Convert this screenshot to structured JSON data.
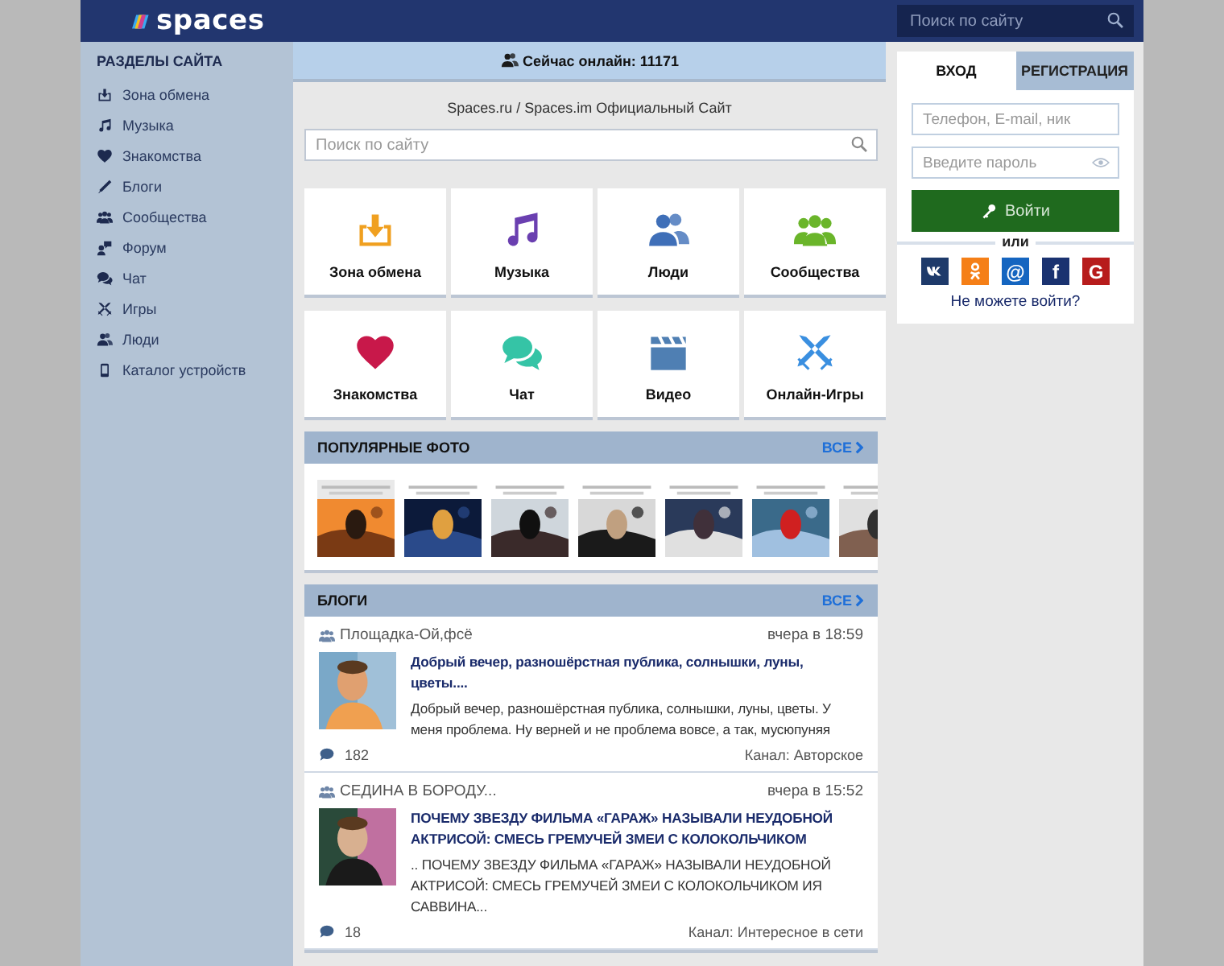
{
  "header": {
    "logo": "spaces",
    "search_placeholder": "Поиск по сайту"
  },
  "sidebar": {
    "title": "РАЗДЕЛЫ САЙТА",
    "items": [
      {
        "label": "Зона обмена",
        "kind": "exchange"
      },
      {
        "label": "Музыка",
        "kind": "music"
      },
      {
        "label": "Знакомства",
        "kind": "dating"
      },
      {
        "label": "Блоги",
        "kind": "blogs"
      },
      {
        "label": "Сообщества",
        "kind": "communities"
      },
      {
        "label": "Форум",
        "kind": "forum"
      },
      {
        "label": "Чат",
        "kind": "chat"
      },
      {
        "label": "Игры",
        "kind": "games"
      },
      {
        "label": "Люди",
        "kind": "people"
      },
      {
        "label": "Каталог устройств",
        "kind": "devices"
      }
    ]
  },
  "online": "Сейчас онлайн: 11171",
  "site_title": "Spaces.ru / Spaces.im Официальный Сайт",
  "search_placeholder": "Поиск по сайту",
  "tiles": [
    {
      "label": "Зона обмена",
      "kind": "exchange"
    },
    {
      "label": "Музыка",
      "kind": "music"
    },
    {
      "label": "Люди",
      "kind": "people"
    },
    {
      "label": "Сообщества",
      "kind": "communities"
    },
    {
      "label": "Знакомства",
      "kind": "dating"
    },
    {
      "label": "Чат",
      "kind": "chat"
    },
    {
      "label": "Видео",
      "kind": "video"
    },
    {
      "label": "Онлайн-Игры",
      "kind": "games"
    }
  ],
  "photos": {
    "title": "ПОПУЛЯРНЫЕ ФОТО",
    "more": "ВСЕ"
  },
  "blogs": {
    "title": "БЛОГИ",
    "more": "ВСЕ",
    "posts": [
      {
        "author": "Площадка-Ой,фсё",
        "time": "вчера в 18:59",
        "title": "Добрый вечер, разношёрстная публика, солнышки, луны, цветы....",
        "text": "Добрый вечер, разношёрстная публика, солнышки, луны, цветы. У меня проблема. Ну верней и не проблема вовсе, а так, мусюпуняя",
        "comments": "182",
        "channel": "Канал: Авторское"
      },
      {
        "author": "СЕДИНА В БОРОДУ...",
        "time": "вчера в 15:52",
        "title": "ПОЧЕМУ ЗВЕЗДУ ФИЛЬМА «ГАРАЖ» НАЗЫВАЛИ НЕУДОБНОЙ АКТРИСОЙ: СМЕСЬ ГРЕМУЧЕЙ ЗМЕИ С КОЛОКОЛЬЧИКОМ",
        "text": ".. ПОЧЕМУ ЗВЕЗДУ ФИЛЬМА «ГАРАЖ» НАЗЫВАЛИ НЕУДОБНОЙ АКТРИСОЙ: СМЕСЬ ГРЕМУЧЕЙ ЗМЕИ С КОЛОКОЛЬЧИКОМ ИЯ САВВИНА...",
        "comments": "18",
        "channel": "Канал: Интересное в сети"
      }
    ]
  },
  "login": {
    "tabs": [
      {
        "label": "ВХОД",
        "selected": true
      },
      {
        "label": "РЕГИСТРАЦИЯ",
        "selected": false
      }
    ],
    "login_placeholder": "Телефон, E-mail, ник",
    "password_placeholder": "Введите пароль",
    "submit": "Войти",
    "or": "или",
    "social": [
      {
        "kind": "vk",
        "color": "#1e3a6a"
      },
      {
        "kind": "ok",
        "color": "#f57f17"
      },
      {
        "kind": "mail",
        "glyph": "@",
        "color": "#1565c0"
      },
      {
        "kind": "facebook",
        "glyph": "f",
        "color": "#1a3270"
      },
      {
        "kind": "google",
        "glyph": "G",
        "color": "#b71c1c"
      }
    ],
    "forgot": "Не можете войти?"
  }
}
